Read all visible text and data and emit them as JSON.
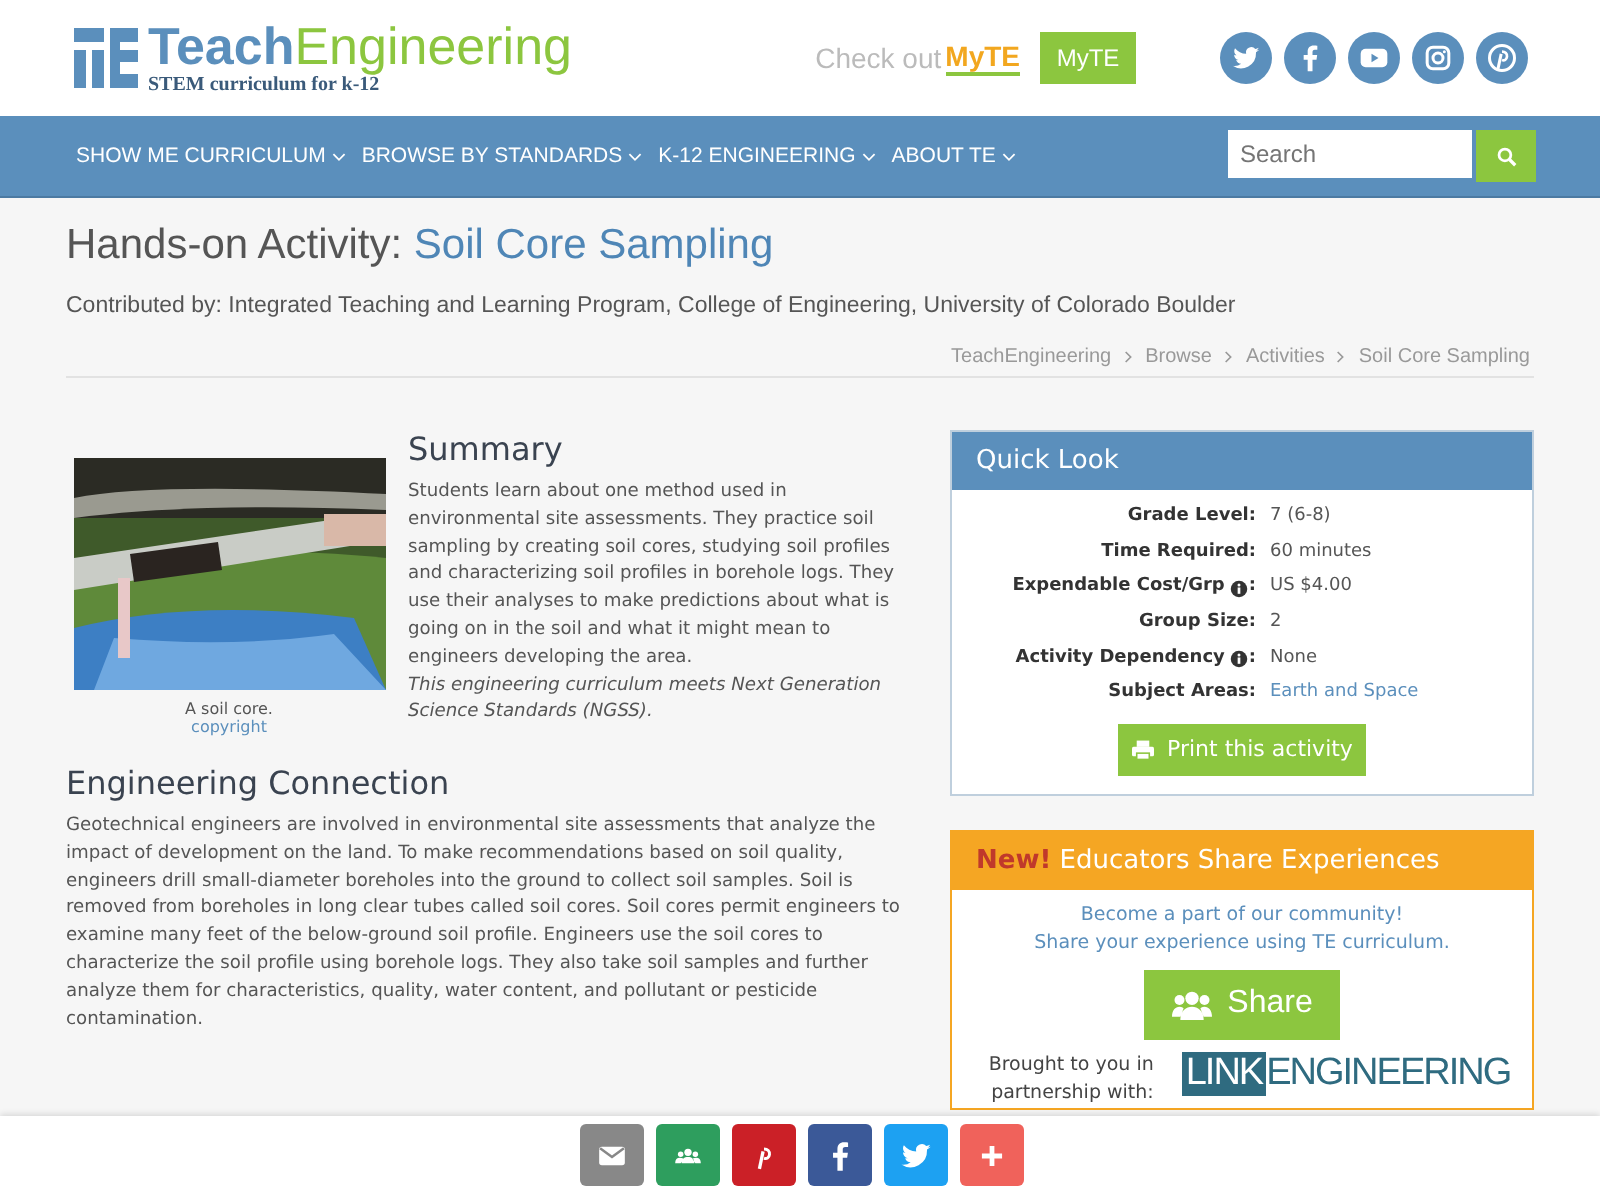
{
  "header": {
    "brand_first": "Teach",
    "brand_second": "Engineering",
    "tagline": "STEM curriculum for k-12",
    "promo": "Check out",
    "promo_brand": "MyTE",
    "myte_button": "MyTE",
    "social": [
      {
        "kind": "twitter"
      },
      {
        "kind": "facebook"
      },
      {
        "kind": "youtube"
      },
      {
        "kind": "instagram"
      },
      {
        "kind": "pinterest"
      }
    ]
  },
  "nav": {
    "items": [
      {
        "label": "SHOW ME CURRICULUM"
      },
      {
        "label": "BROWSE BY STANDARDS"
      },
      {
        "label": "K-12 ENGINEERING"
      },
      {
        "label": "ABOUT TE"
      }
    ],
    "search": {
      "placeholder": "Search"
    }
  },
  "page": {
    "title_prefix": "Hands-on Activity:",
    "title": "Soil Core Sampling",
    "contributed": "Contributed by: Integrated Teaching and Learning Program, College of Engineering, University of Colorado Boulder",
    "breadcrumbs": [
      "TeachEngineering",
      "Browse",
      "Activities",
      "Soil Core Sampling"
    ]
  },
  "summary": {
    "photo": {
      "kind": "picture",
      "caption": "A soil core.",
      "credit": "copyright"
    },
    "heading": "Summary",
    "text": "Students learn about one method used in environmental site assessments. They practice soil sampling by creating soil cores, studying soil profiles and characterizing soil profiles in borehole logs. They use their analyses to make predictions about what is going on in the soil and what it might mean to engineers developing the area.",
    "ngss": "This engineering curriculum meets Next Generation Science Standards (NGSS)."
  },
  "engineering_connection": {
    "heading": "Engineering Connection",
    "text": "Geotechnical engineers are involved in environmental site assessments that analyze the impact of development on the land. To make recommendations based on soil quality, engineers drill small-diameter boreholes into the ground to collect soil samples. Soil is removed from boreholes in long clear tubes called soil cores. Soil cores permit engineers to examine many feet of the below-ground soil profile. Engineers use the soil cores to characterize the soil profile using borehole logs. They also take soil samples and further analyze them for characteristics, quality, water content, and pollutant or pesticide contamination."
  },
  "quick_look": {
    "title": "Quick Look",
    "rows": [
      {
        "label": "Grade Level",
        "separator": ":",
        "info": false,
        "value": "7 (6-8)",
        "link": false
      },
      {
        "label": "Time Required",
        "separator": ":",
        "info": false,
        "value": "60 minutes",
        "link": false
      },
      {
        "label": "Expendable Cost/Grp",
        "separator": ":",
        "info": true,
        "value": "US $4.00",
        "link": false
      },
      {
        "label": "Group Size",
        "separator": ":",
        "info": false,
        "value": "2",
        "link": false
      },
      {
        "label": "Activity Dependency",
        "separator": ":",
        "info": true,
        "value": "None",
        "link": false
      },
      {
        "label": "Subject Areas",
        "separator": ":",
        "info": false,
        "value": "Earth and Space",
        "link": true
      }
    ],
    "print_button": "Print this activity"
  },
  "share_panel": {
    "badge": "New!",
    "title": "Educators Share Experiences",
    "lines": [
      "Become a part of our community!",
      "Share your experience using TE curriculum."
    ],
    "button": "Share",
    "brought": "Brought to you in partnership with:",
    "partner_a": "LINK",
    "partner_b": "ENGINEERING"
  },
  "share_bar": [
    {
      "kind": "email"
    },
    {
      "kind": "group"
    },
    {
      "kind": "pinterest"
    },
    {
      "kind": "facebook"
    },
    {
      "kind": "twitter"
    },
    {
      "kind": "plus"
    }
  ]
}
